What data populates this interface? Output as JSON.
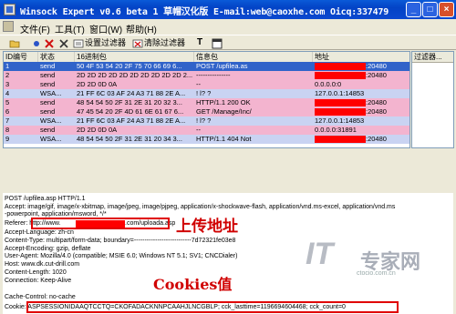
{
  "window": {
    "title": "Winsock Expert v0.6 beta 1 草帽汉化版 E-mail:web@caoxhe.com Oicq:337479",
    "min_label": "_",
    "max_label": "□",
    "close_label": "×"
  },
  "menu": [
    "文件(F)",
    "工具(T)",
    "窗口(W)",
    "帮助(H)"
  ],
  "toolbar": {
    "set_filter": "设置过滤器",
    "clear_filter": "清除过滤器",
    "t_label": "T"
  },
  "columns": [
    "ID编号",
    "状态",
    "16进制包",
    "信息包",
    "地址",
    "过滤器..."
  ],
  "rows": [
    {
      "id": "1",
      "status": "send",
      "hex": "50 4F 53 54 20 2F 75 70 66 69 6...",
      "info": "POST /upfilea.as",
      "addr_suffix": ":20480",
      "addr_redacted": true,
      "color": "#3163c9",
      "fg": "#ffffff"
    },
    {
      "id": "2",
      "status": "send",
      "hex": "2D 2D 2D 2D 2D 2D 2D 2D 2D 2D 2...",
      "info": "---------------",
      "addr_suffix": ":20480",
      "addr_redacted": true,
      "color": "#f3b4cf",
      "fg": "#000000"
    },
    {
      "id": "3",
      "status": "send",
      "hex": "2D 2D 0D 0A",
      "info": "--",
      "addr": "0.0.0.0:0",
      "color": "#f3b4cf",
      "fg": "#000000"
    },
    {
      "id": "4",
      "status": "WSA...",
      "hex": "21 FF 6C 03 AF 24 A3 71 88 2E A...",
      "info": "! l? ?",
      "addr": "127.0.0.1:14853",
      "color": "#c9d3f2",
      "fg": "#000000"
    },
    {
      "id": "5",
      "status": "send",
      "hex": "48 54 54 50 2F 31 2E 31 20 32 3...",
      "info": "HTTP/1.1 200 OK",
      "addr_suffix": ":20480",
      "addr_redacted": true,
      "color": "#f3b4cf",
      "fg": "#000000"
    },
    {
      "id": "6",
      "status": "send",
      "hex": "47 45 54 20 2F 4D 61 6E 61 67 6...",
      "info": "GET /Manage/Inc/",
      "addr_suffix": ":20480",
      "addr_redacted": true,
      "color": "#f3b4cf",
      "fg": "#000000"
    },
    {
      "id": "7",
      "status": "WSA...",
      "hex": "21 FF 6C 03 AF 24 A3 71 88 2E A...",
      "info": "! l? ?",
      "addr": "127.0.0.1:14853",
      "color": "#c9d3f2",
      "fg": "#000000"
    },
    {
      "id": "8",
      "status": "send",
      "hex": "2D 2D 0D 0A",
      "info": "--",
      "addr": "0.0.0.0:31891",
      "color": "#f3b4cf",
      "fg": "#000000"
    },
    {
      "id": "9",
      "status": "WSA...",
      "hex": "48 54 54 50 2F 31 2E 31 20 34 3...",
      "info": "HTTP/1.1 404 Not",
      "addr_suffix": ":20480",
      "addr_redacted": true,
      "color": "#c9d3f2",
      "fg": "#000000"
    }
  ],
  "detail": {
    "lines": [
      "POST /upfilea.asp HTTP/1.1",
      "Accept: image/gif, image/x-xbitmap, image/jpeg, image/pjpeg, application/x-shockwave-flash, application/vnd.ms-excel, application/vnd.ms",
      "-powerpoint, application/msword, */*",
      "Referer: http://www.",
      "Accept-Language: zh-cn",
      "Content-Type: multipart/form-data; boundary=---------------------------7d72321fe03e8",
      "Accept-Encoding: gzip, deflate",
      "User-Agent: Mozilla/4.0 (compatible; MSIE 6.0; Windows NT 5.1; SV1; CNCDialer)",
      "Host: www.dk.cut-drill.com",
      "Content-Length: 1020",
      "Connection: Keep-Alive",
      "Cache-Control: no-cache",
      "Cookie: ASPSESSIONIDAAQTCCTQ=CKOFADACKNNPCAAHJLNCGBLP; cck_lasttime=1196694604468; cck_count=0"
    ],
    "referer_suffix": ".com/uploada.asp",
    "annotation_upload": "上传地址",
    "annotation_cookies": "Cookies值"
  },
  "watermark": {
    "it": "IT",
    "cn": "专家网",
    "url": "ctocio.com.cn"
  }
}
